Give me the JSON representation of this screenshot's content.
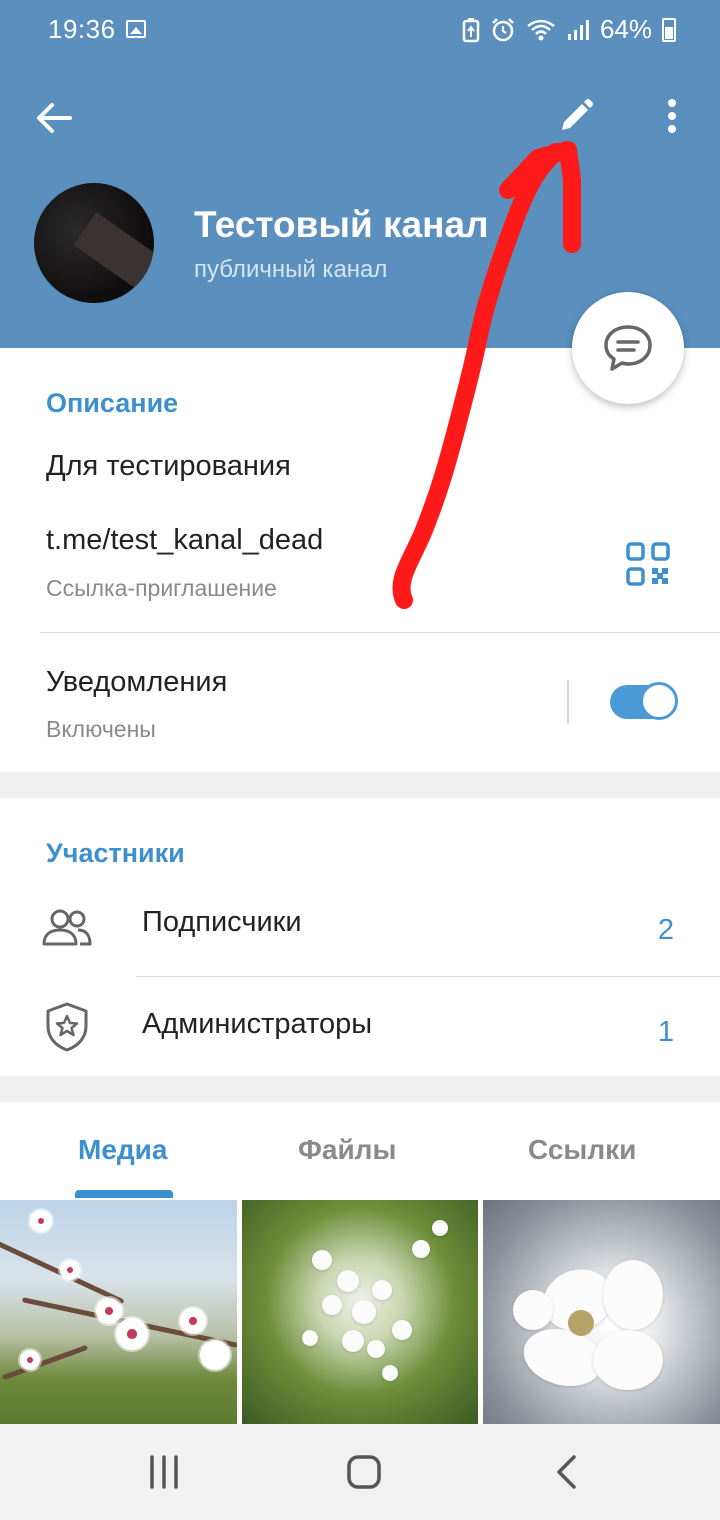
{
  "status_bar": {
    "time": "19:36",
    "battery": "64%"
  },
  "toolbar": {
    "back": "back-arrow-icon",
    "edit": "pencil-icon",
    "more": "more-vertical-icon"
  },
  "channel": {
    "title": "Тестовый канал",
    "subtitle": "публичный канал"
  },
  "info": {
    "description_title": "Описание",
    "description_text": "Для тестирования",
    "link": "t.me/test_kanal_dead",
    "link_caption": "Ссылка-приглашение",
    "notifications_label": "Уведомления",
    "notifications_state": "Включены",
    "notifications_on": true
  },
  "members": {
    "title": "Участники",
    "items": [
      {
        "label": "Подписчики",
        "count": "2",
        "icon": "people-icon"
      },
      {
        "label": "Администраторы",
        "count": "1",
        "icon": "shield-star-icon"
      }
    ]
  },
  "tabs": [
    {
      "label": "Медиа",
      "active": true
    },
    {
      "label": "Файлы",
      "active": false
    },
    {
      "label": "Ссылки",
      "active": false
    }
  ],
  "colors": {
    "header": "#5a8fbe",
    "accent": "#3d8fce",
    "annotation": "#ff0000"
  },
  "media": [
    "blossom-branch-photo",
    "bird-cherry-photo",
    "white-flower-photo"
  ]
}
